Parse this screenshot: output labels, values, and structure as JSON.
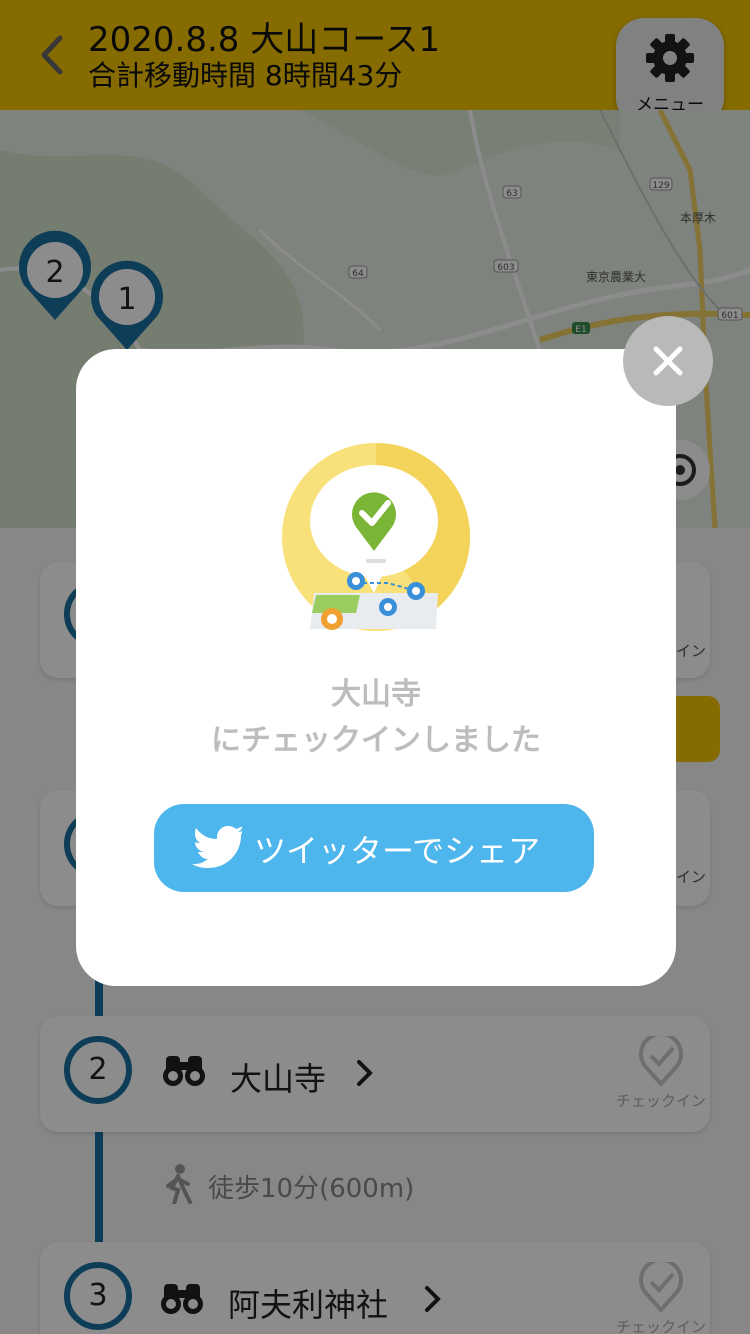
{
  "header": {
    "title": "2020.8.8 大山コース1",
    "subtitle": "合計移動時間  8時間43分",
    "menu_label": "メニュー"
  },
  "map": {
    "labels": [
      "東京農業大",
      "本厚木",
      "63",
      "64",
      "603",
      "129",
      "601",
      "E1"
    ],
    "pins": [
      "2",
      "1"
    ]
  },
  "list": {
    "peek_checkin_1": "イン",
    "peek_checkin_2": "イン",
    "items": [
      {
        "number": "2",
        "name": "大山寺",
        "checkin_label": "チェックイン"
      },
      {
        "number": "3",
        "name": "阿夫利神社",
        "checkin_label": "チェックイン"
      }
    ],
    "walk": "徒歩10分(600m)"
  },
  "modal": {
    "spot_name": "大山寺",
    "checkin_message": "にチェックインしました",
    "share_label": "ツイッターでシェア"
  },
  "colors": {
    "header": "#f2c400",
    "timeline": "#1a6fa0",
    "twitter": "#4db6ec",
    "check_green": "#7ab535"
  }
}
